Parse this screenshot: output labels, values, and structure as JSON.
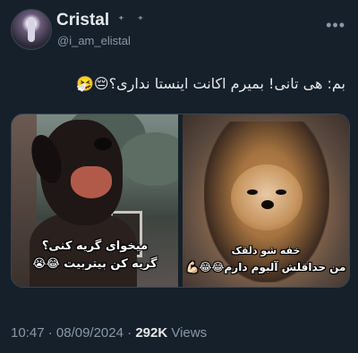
{
  "author": {
    "display_name": "Cristal",
    "name_decoration": "⁺ ⁺",
    "handle": "@i_am_elistal"
  },
  "more_icon": "more-horizontal-icon",
  "tweet": {
    "text": "بم: هی تانی! بمیرم اکانت اینستا نداری؟😔🤧"
  },
  "media": {
    "left": {
      "caption_line1": "میخوای گریه کنی؟",
      "caption_line2": "گریه کن بیتربیت 😂😭"
    },
    "right": {
      "caption_line1": "خفه شو دلقک",
      "caption_line2": "من حداقلش آلبوم دارم😂😂💪🏻"
    }
  },
  "meta": {
    "time": "10:47",
    "separator1": "·",
    "date": "08/09/2024",
    "separator2": "·",
    "views_count": "292K",
    "views_label": "Views"
  }
}
